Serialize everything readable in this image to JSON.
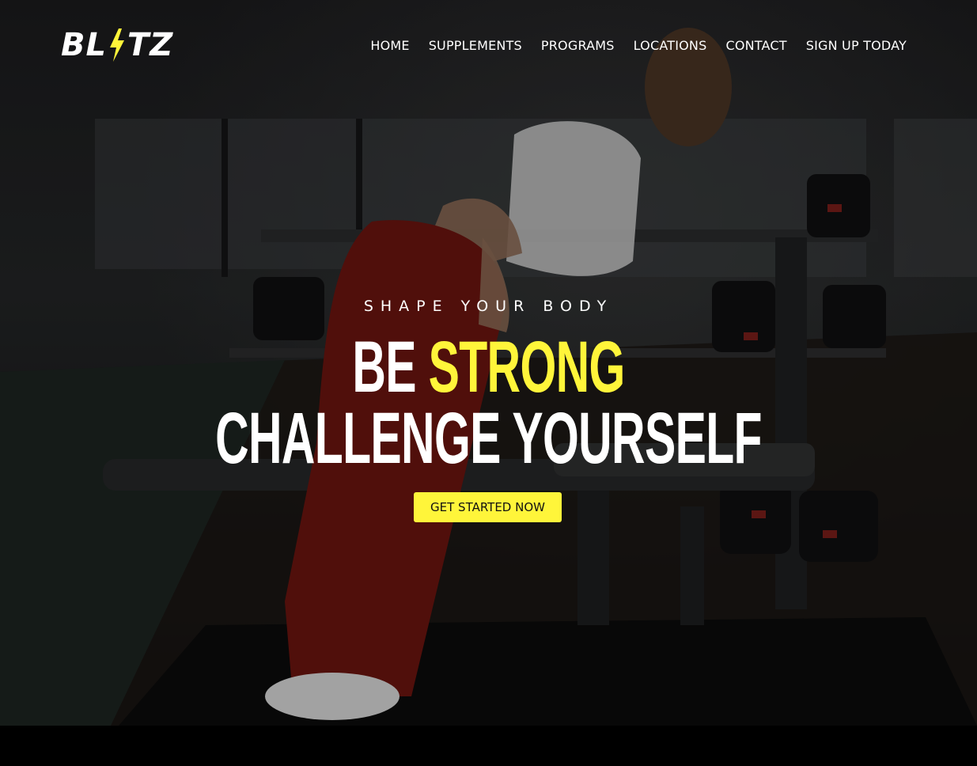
{
  "brand": {
    "logo_left": "BL",
    "logo_right": "TZ",
    "accent_color": "#fff53a"
  },
  "nav": {
    "items": [
      {
        "label": "HOME"
      },
      {
        "label": "SUPPLEMENTS"
      },
      {
        "label": "PROGRAMS"
      },
      {
        "label": "LOCATIONS"
      },
      {
        "label": "CONTACT"
      },
      {
        "label": "SIGN UP TODAY"
      }
    ]
  },
  "hero": {
    "kicker": "SHAPE YOUR BODY",
    "headline_prefix": "BE",
    "headline_highlight": "STRONG",
    "headline_line2": "CHALLENGE YOURSELF",
    "cta_label": "GET STARTED NOW",
    "background_image": "gym-woman-dumbbell-row-photo"
  }
}
